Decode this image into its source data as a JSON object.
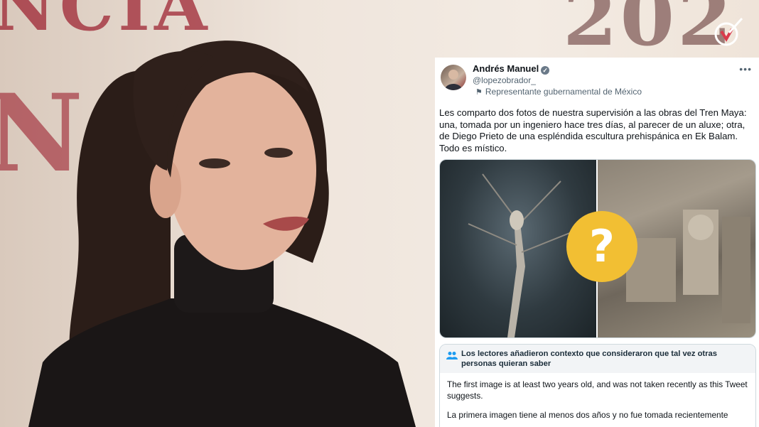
{
  "background": {
    "banner_top": "NCIA",
    "banner_mid": "NS",
    "year": "202"
  },
  "tweet": {
    "author_name": "Andrés Manuel",
    "handle": "@lopezobrador_",
    "affiliation": "Representante gubernamental de México",
    "more_label": "•••",
    "text": "Les comparto dos fotos de nuestra supervisión a las obras del Tren Maya: una, tomada por un ingeniero hace tres días, al parecer de un aluxe; otra, de Diego Prieto de una espléndida escultura prehispánica en Ek Balam. Todo es místico.",
    "overlay_symbol": "?"
  },
  "community_note": {
    "header": "Los lectores añadieron contexto que consideraron que tal vez otras personas quieran saber",
    "paragraph_en": "The first image is at least two years old, and was not taken recently as this Tweet suggests.",
    "paragraph_es": "La primera imagen tiene al menos dos años y no fue tomada recientemente"
  },
  "colors": {
    "banner_red": "#9c1f2e",
    "question_badge": "#f2bf33",
    "link_gray": "#536471"
  },
  "icons": [
    "flag-icon",
    "verified-badge-icon",
    "people-icon",
    "more-options-icon",
    "brand-logo-icon"
  ]
}
